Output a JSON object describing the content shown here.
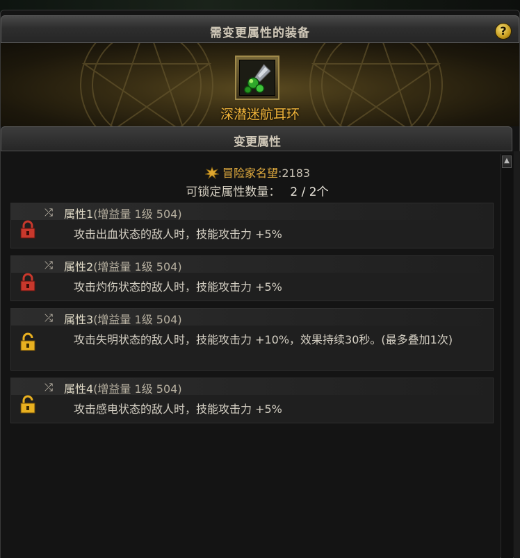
{
  "window": {
    "title": "需变更属性的装备",
    "help_label": "?"
  },
  "equipment": {
    "name": "深潜迷航耳环",
    "icon": "earring-icon"
  },
  "section": {
    "title": "变更属性"
  },
  "fame": {
    "label": "冒险家名望",
    "separator": ":",
    "value": "2183",
    "icon": "fame-crest-icon"
  },
  "lock_info": {
    "label": "可锁定属性数量：",
    "count": "2 / 2个"
  },
  "attributes": [
    {
      "name": "属性1",
      "level": "(增益量 1级 504)",
      "desc": "攻击出血状态的敌人时，技能攻击力 +5%",
      "locked": true
    },
    {
      "name": "属性2",
      "level": "(增益量 1级 504)",
      "desc": "攻击灼伤状态的敌人时，技能攻击力 +5%",
      "locked": true
    },
    {
      "name": "属性3",
      "level": "(增益量 1级 504)",
      "desc": "攻击失明状态的敌人时，技能攻击力 +10%，效果持续30秒。(最多叠加1次)",
      "locked": false
    },
    {
      "name": "属性4",
      "level": "(增益量 1级 504)",
      "desc": "攻击感电状态的敌人时，技能攻击力 +5%",
      "locked": false
    }
  ],
  "colors": {
    "locked": "#c8382c",
    "unlocked": "#e8b020",
    "equip_name": "#f0b43a"
  }
}
